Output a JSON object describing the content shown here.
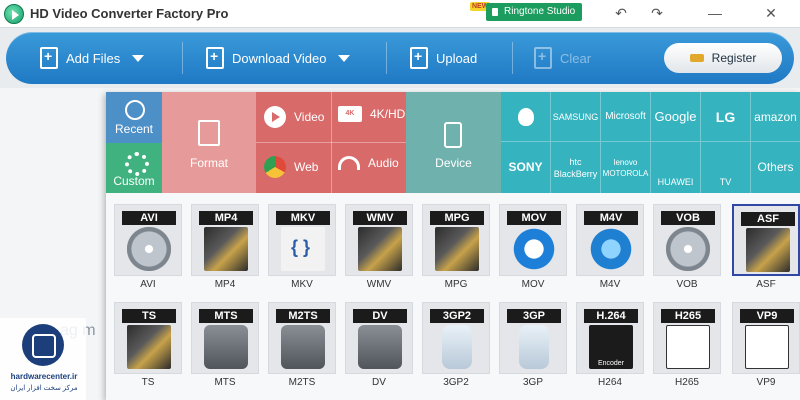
{
  "app": {
    "title": "HD Video Converter Factory Pro",
    "ringtone_badge": "NEW",
    "ringtone_label": "Ringtone Studio"
  },
  "window_controls": [
    "↶",
    "↷",
    "—",
    "✕"
  ],
  "toolbar": {
    "add_files": "Add Files",
    "download_video": "Download Video",
    "upload": "Upload",
    "clear": "Clear",
    "register": "Register"
  },
  "workspace": {
    "hint": "ag m"
  },
  "categories": {
    "recent": "Recent",
    "custom": "Custom",
    "format": "Format",
    "video": "Video",
    "hd": "4K/HD",
    "hd_icon": "4K",
    "web": "Web",
    "audio": "Audio",
    "device": "Device"
  },
  "brands": [
    {
      "name": "",
      "icon": "apple-icon"
    },
    {
      "name": "SAMSUNG"
    },
    {
      "name": "Microsoft"
    },
    {
      "name": "Google"
    },
    {
      "name": "LG"
    },
    {
      "name": "amazon"
    },
    {
      "name": "SONY"
    },
    {
      "name": "htc BlackBerry"
    },
    {
      "name": "lenovo MOTOROLA"
    },
    {
      "name": "HUAWEI"
    },
    {
      "name": "TV"
    },
    {
      "name": "Others"
    }
  ],
  "formats_row1": [
    "AVI",
    "MP4",
    "MKV",
    "WMV",
    "MPG",
    "MOV",
    "M4V",
    "VOB",
    "ASF"
  ],
  "formats_row1_labels": [
    "AVI",
    "MP4",
    "MKV",
    "WMV",
    "MPG",
    "MOV",
    "M4V",
    "VOB",
    "ASF"
  ],
  "formats_row2": [
    "TS",
    "MTS",
    "M2TS",
    "DV",
    "3GP2",
    "3GP",
    "H.264",
    "H265",
    "VP9"
  ],
  "formats_row2_labels": [
    "TS",
    "MTS",
    "M2TS",
    "DV",
    "3GP2",
    "3GP",
    "H264",
    "H265",
    "VP9"
  ],
  "selected_format": "ASF",
  "watermark": {
    "line1": "hardwarecenter.ir",
    "line2": "مرکز سخت افزار ایران"
  },
  "colors": {
    "toolbar": "#2a87cf",
    "recent": "#4d8fc7",
    "custom": "#3fb27f",
    "format": "#e79a9a",
    "device": "#6fb1ad",
    "brands": "#35b3bf"
  }
}
